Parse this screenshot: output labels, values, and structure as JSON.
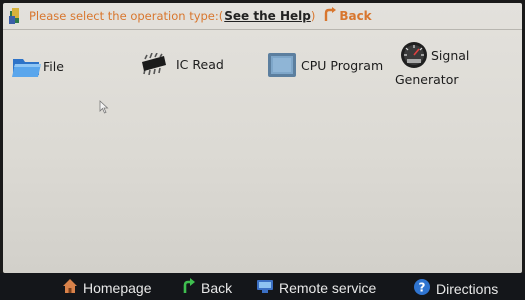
{
  "header": {
    "prompt": "Please select the operation type:(",
    "help_link": "See the Help",
    "paren_close": ")",
    "back_label": "Back"
  },
  "items": [
    {
      "label": "File",
      "icon": "folder-icon"
    },
    {
      "label": "IC Read",
      "icon": "chip-icon"
    },
    {
      "label": "CPU Program",
      "icon": "cpu-program-icon"
    },
    {
      "label_line1": "Signal",
      "label_line2": "Generator",
      "icon": "gauge-icon"
    }
  ],
  "bottom_nav": {
    "homepage": "Homepage",
    "back": "Back",
    "remote_service": "Remote service",
    "directions": "Directions"
  },
  "colors": {
    "prompt_orange": "#d8762e",
    "screen_bg": "#dcdad4",
    "bottom_bar": "#14161a"
  }
}
